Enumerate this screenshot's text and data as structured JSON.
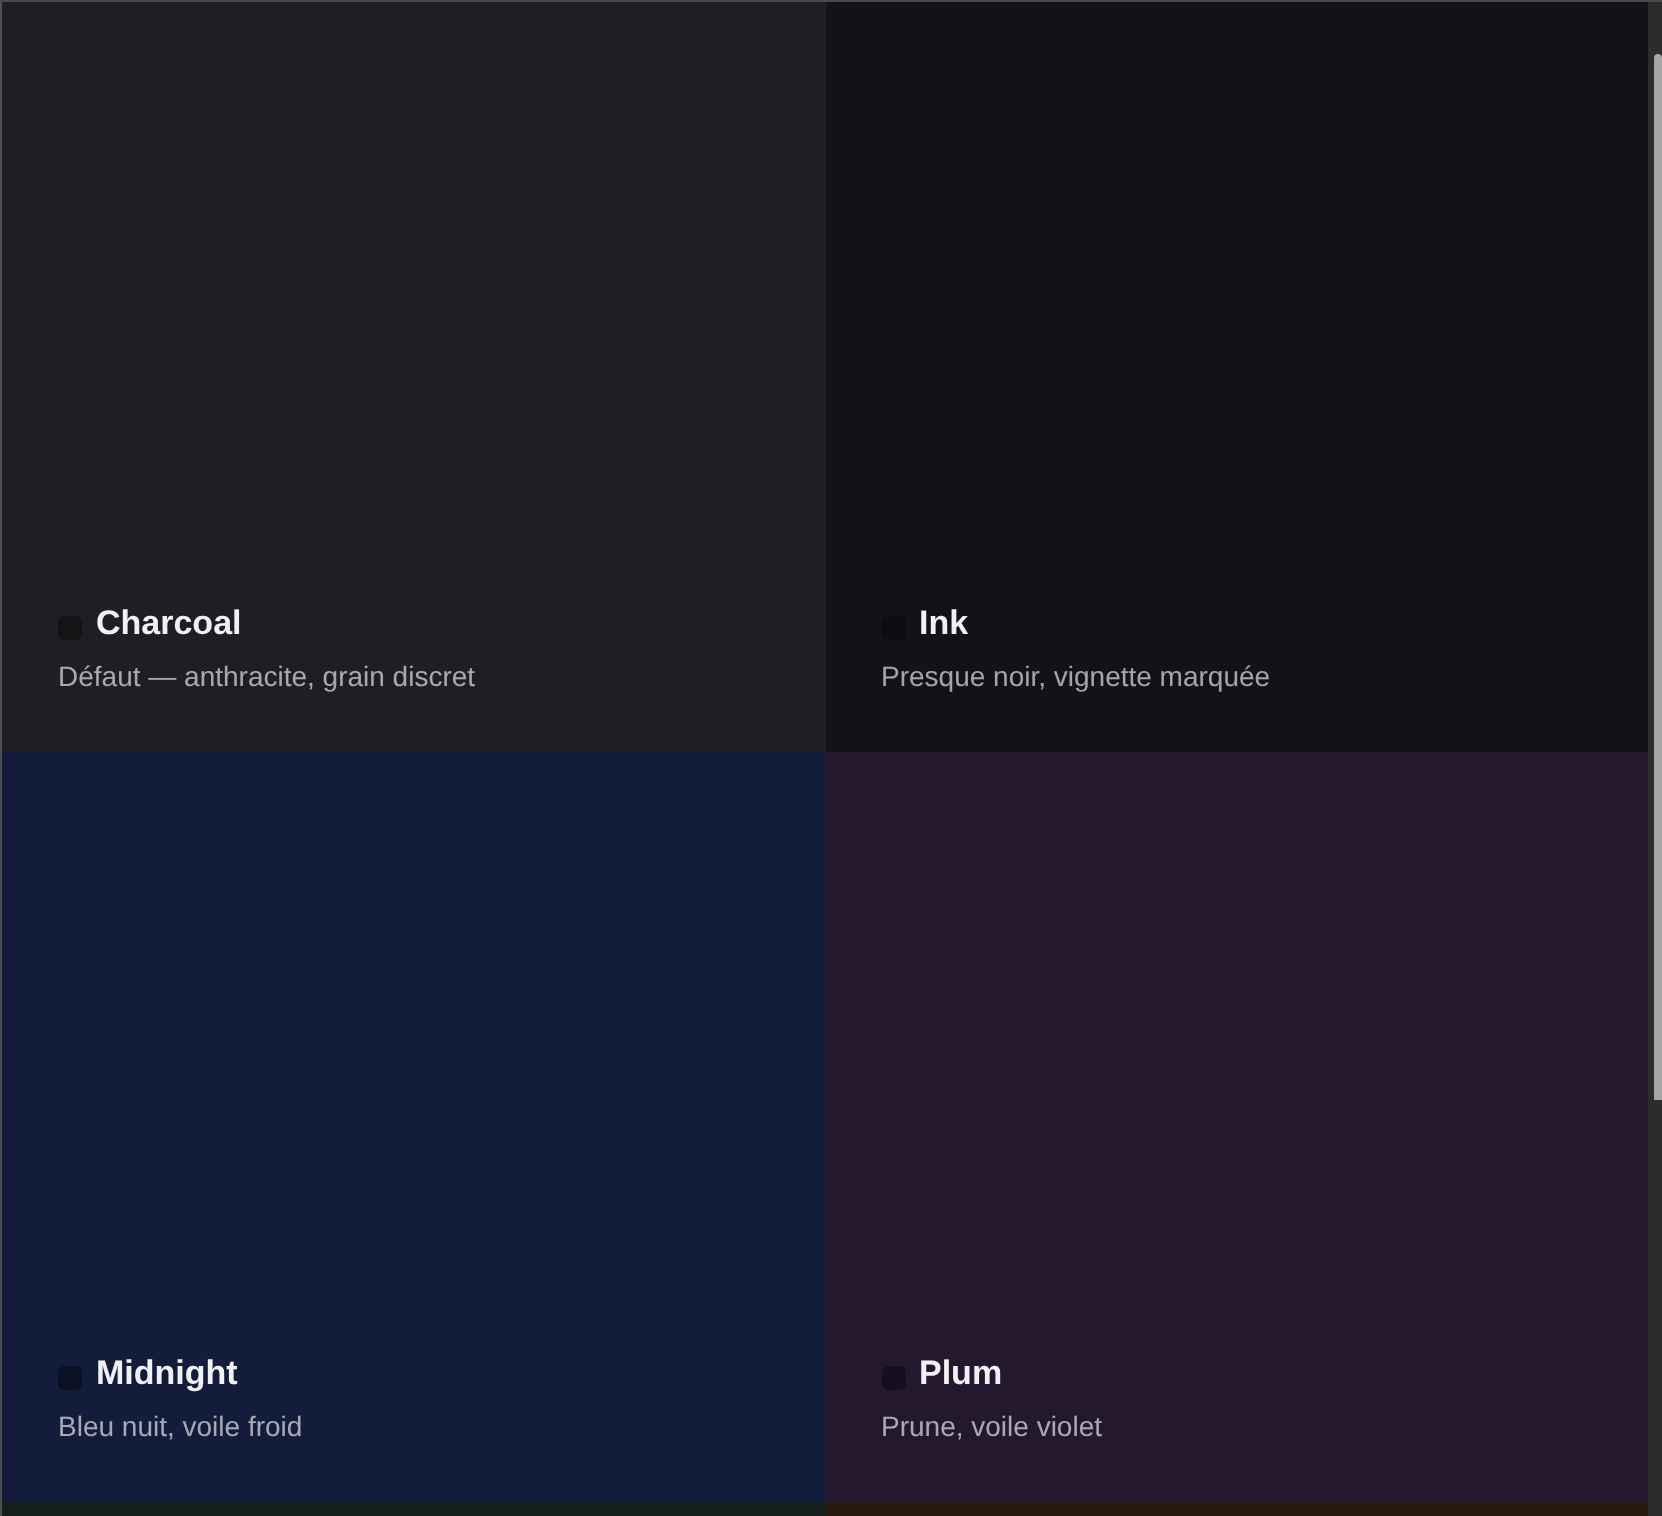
{
  "themes": [
    {
      "name": "Charcoal",
      "description": "Défaut — anthracite, grain discret",
      "color": "#1e1f23"
    },
    {
      "name": "Ink",
      "description": "Presque noir, vignette marquée",
      "color": "#121318"
    },
    {
      "name": "Midnight",
      "description": "Bleu nuit, voile froid",
      "color": "#131d3b"
    },
    {
      "name": "Plum",
      "description": "Prune, voile violet",
      "color": "#24182f"
    },
    {
      "color": "#15201a"
    },
    {
      "color": "#2a1911"
    }
  ]
}
